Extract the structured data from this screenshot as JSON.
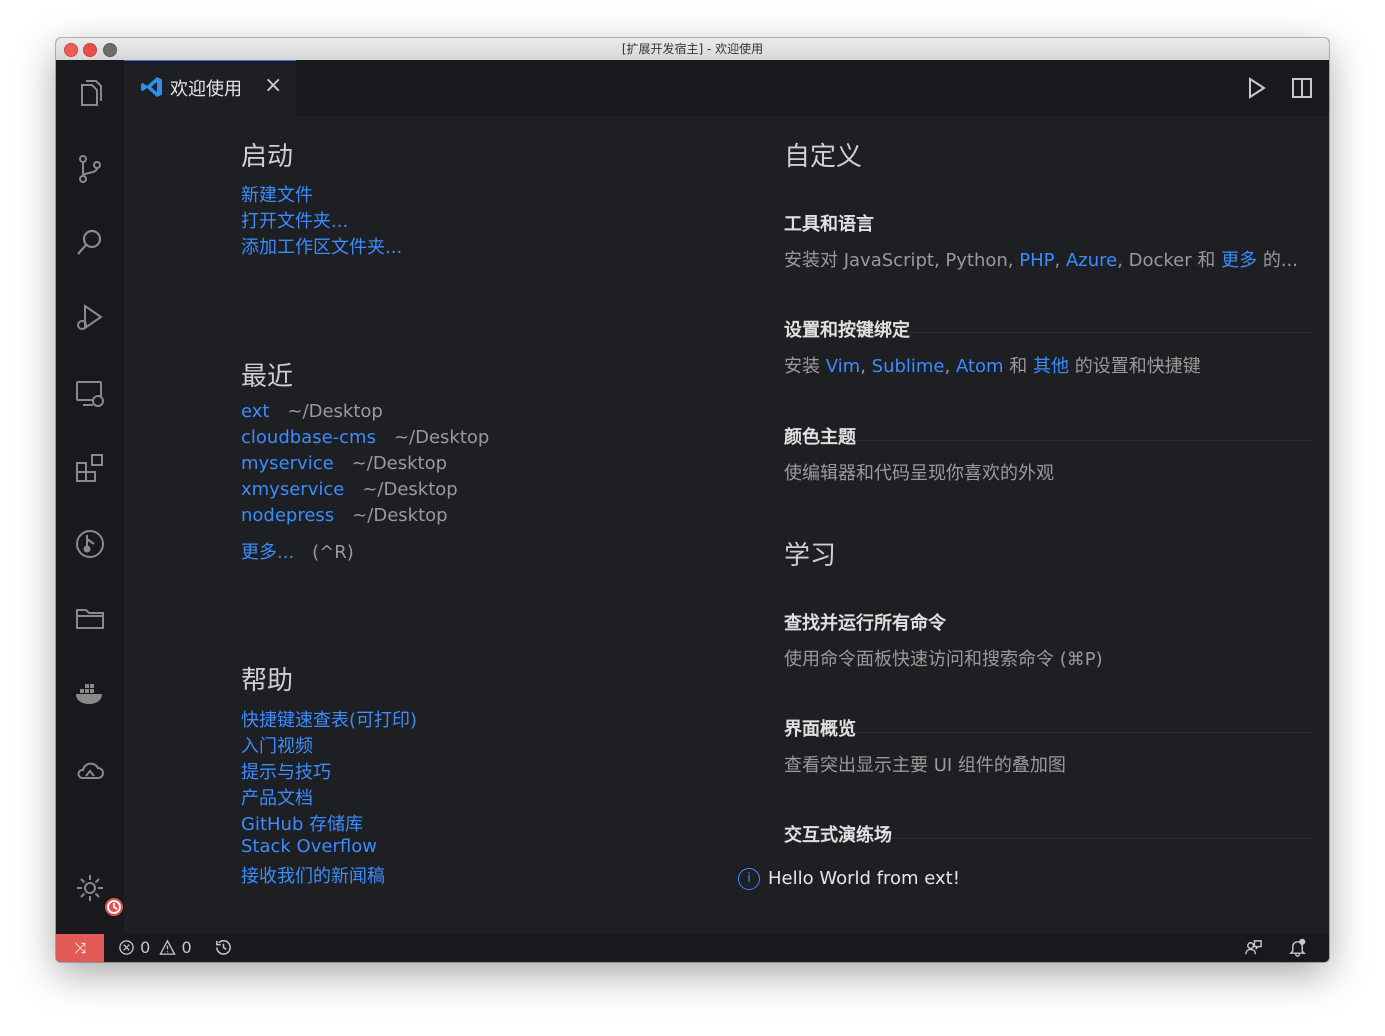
{
  "window": {
    "title": "[扩展开发宿主] - 欢迎使用"
  },
  "tab": {
    "label": "欢迎使用",
    "close": "×"
  },
  "start": {
    "title": "启动",
    "links": [
      "新建文件",
      "打开文件夹...",
      "添加工作区文件夹..."
    ]
  },
  "recent": {
    "title": "最近",
    "items": [
      {
        "name": "ext",
        "path": "~/Desktop"
      },
      {
        "name": "cloudbase-cms",
        "path": "~/Desktop"
      },
      {
        "name": "myservice",
        "path": "~/Desktop"
      },
      {
        "name": "xmyservice",
        "path": "~/Desktop"
      },
      {
        "name": "nodepress",
        "path": "~/Desktop"
      }
    ],
    "more": "更多...",
    "more_shortcut": "(^R)"
  },
  "help": {
    "title": "帮助",
    "links": [
      "快捷键速查表(可打印)",
      "入门视频",
      "提示与技巧",
      "产品文档",
      "GitHub 存储库",
      "Stack Overflow",
      "接收我们的新闻稿"
    ]
  },
  "customize": {
    "title": "自定义",
    "tools": {
      "title": "工具和语言",
      "p1": "安装对 JavaScript, Python, ",
      "php": "PHP",
      "comma": ", ",
      "azure": "Azure",
      "p2": ", Docker 和 ",
      "more": "更多",
      "p3": " 的..."
    },
    "keymaps": {
      "title": "设置和按键绑定",
      "p1": "安装 ",
      "vim": "Vim",
      "c1": ", ",
      "sublime": "Sublime",
      "c2": ", ",
      "atom": "Atom",
      "p2": " 和 ",
      "other": "其他",
      "p3": " 的设置和快捷键"
    },
    "theme": {
      "title": "颜色主题",
      "desc": "使编辑器和代码呈现你喜欢的外观"
    }
  },
  "learn": {
    "title": "学习",
    "commands": {
      "title": "查找并运行所有命令",
      "desc": "使用命令面板快速访问和搜索命令 (⌘P)"
    },
    "overview": {
      "title": "界面概览",
      "desc": "查看突出显示主要 UI 组件的叠加图"
    },
    "playground": {
      "title": "交互式演练场"
    }
  },
  "notification": {
    "icon": "i",
    "text": "Hello World from ext!"
  },
  "statusbar": {
    "errors": "0",
    "warnings": "0",
    "remote_icon": "⤨"
  },
  "colors": {
    "link": "#3c8cff",
    "remote": "#e25a55",
    "background": "#1d1f22"
  }
}
